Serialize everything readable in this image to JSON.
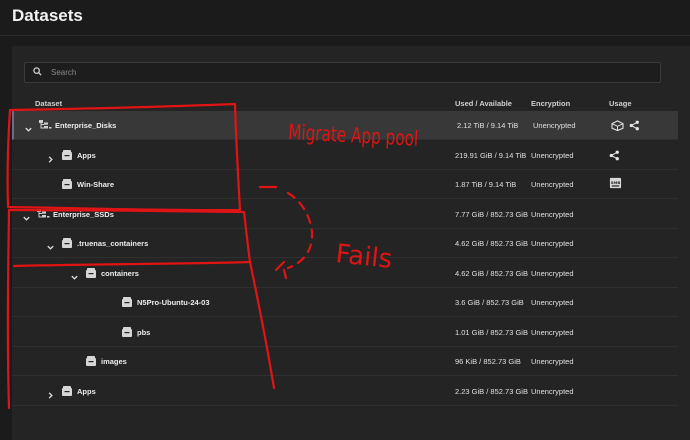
{
  "page": {
    "title": "Datasets"
  },
  "search": {
    "placeholder": "Search",
    "value": ""
  },
  "table": {
    "columns": {
      "dataset": "Dataset",
      "used": "Used / Available",
      "encryption": "Encryption",
      "usage": "Usage"
    },
    "rows": [
      {
        "name": "Enterprise_Disks",
        "used": "2.12 TiB / 9.14 TiB",
        "encryption": "Unencrypted",
        "level": 0,
        "type": "pool",
        "expanded": true,
        "selected": true,
        "usage_icons": [
          "apps-icon",
          "share-icon"
        ]
      },
      {
        "name": "Apps",
        "used": "219.91 GiB / 9.14 TiB",
        "encryption": "Unencrypted",
        "level": 1,
        "type": "dataset",
        "expanded": false,
        "usage_icons": [
          "share-icon"
        ]
      },
      {
        "name": "Win-Share",
        "used": "1.87 TiB / 9.14 TiB",
        "encryption": "Unencrypted",
        "level": 1,
        "type": "dataset",
        "usage_icons": [
          "smb-icon"
        ]
      },
      {
        "name": "Enterprise_SSDs",
        "used": "7.77 GiB / 852.73 GiB",
        "encryption": "Unencrypted",
        "level": 0,
        "type": "pool",
        "expanded": true,
        "usage_icons": []
      },
      {
        "name": ".truenas_containers",
        "used": "4.62 GiB / 852.73 GiB",
        "encryption": "Unencrypted",
        "level": 1,
        "type": "dataset",
        "expanded": true,
        "usage_icons": []
      },
      {
        "name": "containers",
        "used": "4.62 GiB / 852.73 GiB",
        "encryption": "Unencrypted",
        "level": 2,
        "type": "dataset",
        "expanded": true,
        "usage_icons": []
      },
      {
        "name": "N5Pro-Ubuntu-24-03",
        "used": "3.6 GiB / 852.73 GiB",
        "encryption": "Unencrypted",
        "level": 3,
        "type": "dataset",
        "usage_icons": []
      },
      {
        "name": "pbs",
        "used": "1.01 GiB / 852.73 GiB",
        "encryption": "Unencrypted",
        "level": 3,
        "type": "dataset",
        "usage_icons": []
      },
      {
        "name": "images",
        "used": "96 KiB / 852.73 GiB",
        "encryption": "Unencrypted",
        "level": 2,
        "type": "dataset",
        "usage_icons": []
      },
      {
        "name": "Apps",
        "used": "2.23 GiB / 852.73 GiB",
        "encryption": "Unencrypted",
        "level": 1,
        "type": "dataset",
        "expanded": false,
        "usage_icons": []
      }
    ]
  },
  "annotations": {
    "note1": "Migrate App pool",
    "note2": "Fails",
    "ink_color": "#e01414"
  },
  "colors": {
    "background": "#1b1b1b",
    "card": "#242424",
    "selected_row": "#383838"
  }
}
